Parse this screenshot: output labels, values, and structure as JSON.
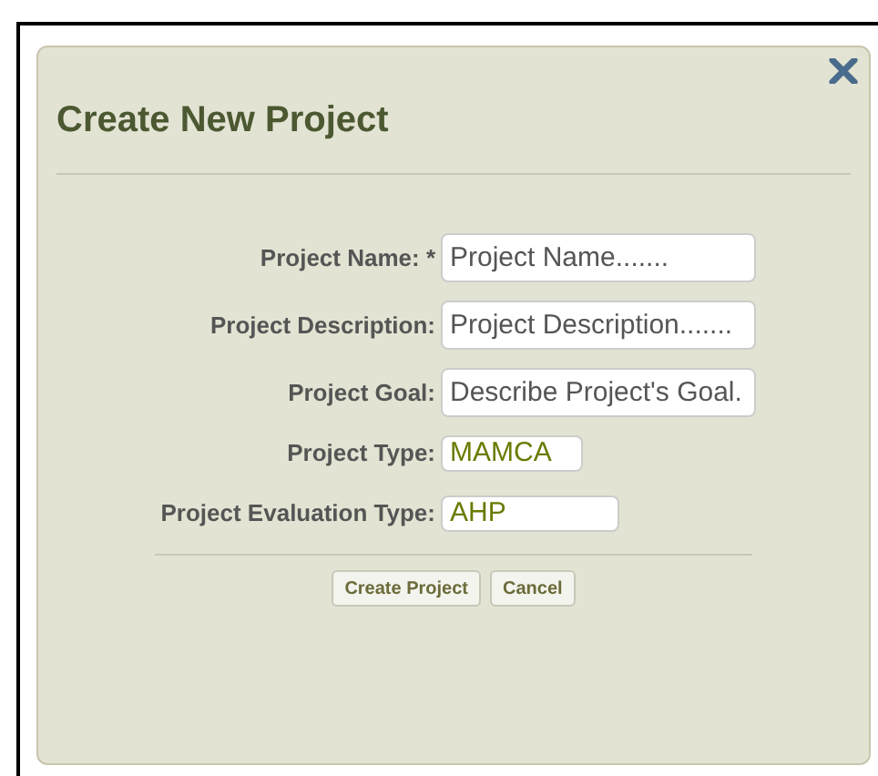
{
  "dialog": {
    "title": "Create New Project",
    "fields": [
      {
        "label": "Project Name: *",
        "placeholder": "Project Name......."
      },
      {
        "label": "Project Description:",
        "placeholder": "Project Description......."
      },
      {
        "label": "Project Goal:",
        "placeholder": "Describe Project's Goal."
      },
      {
        "label": "Project Type:",
        "value": "MAMCA"
      },
      {
        "label": "Project Evaluation Type:",
        "value": "AHP"
      }
    ],
    "buttons": [
      "Create Project",
      "Cancel"
    ]
  }
}
